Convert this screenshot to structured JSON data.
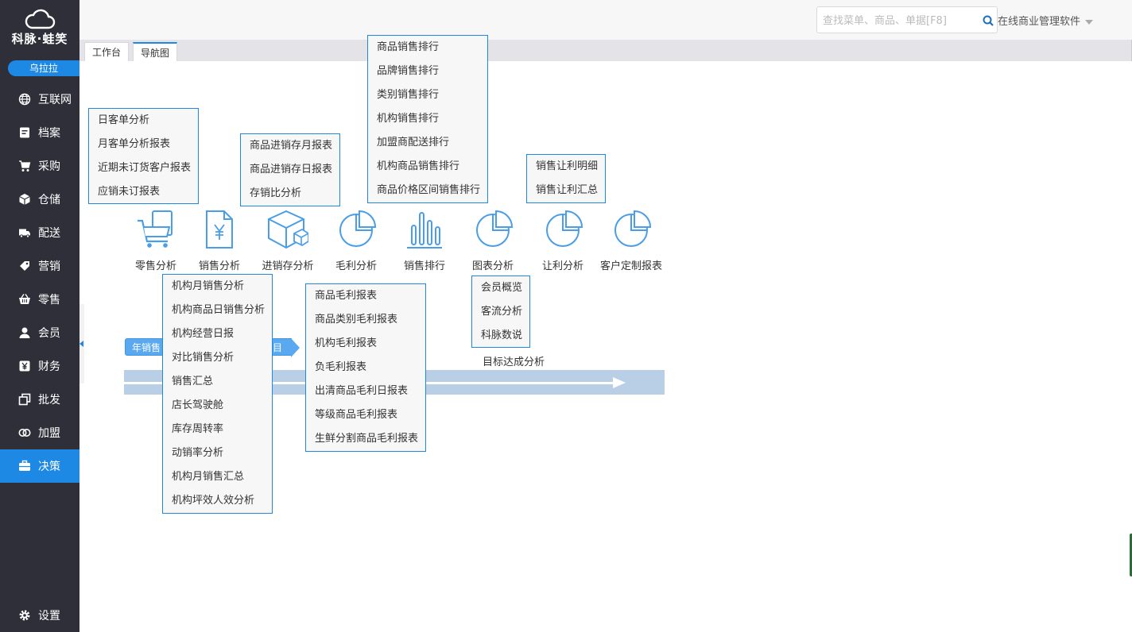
{
  "brand": {
    "name": "科脉·蛙笑",
    "user": "乌拉拉"
  },
  "sidebar": {
    "items": [
      {
        "label": "互联网",
        "icon": "globe-icon"
      },
      {
        "label": "档案",
        "icon": "file-icon"
      },
      {
        "label": "采购",
        "icon": "cart-icon"
      },
      {
        "label": "仓储",
        "icon": "box-icon"
      },
      {
        "label": "配送",
        "icon": "truck-icon"
      },
      {
        "label": "营销",
        "icon": "tag-icon"
      },
      {
        "label": "零售",
        "icon": "basket-icon"
      },
      {
        "label": "会员",
        "icon": "user-icon"
      },
      {
        "label": "财务",
        "icon": "yen-icon"
      },
      {
        "label": "批发",
        "icon": "copy-icon"
      },
      {
        "label": "加盟",
        "icon": "rings-icon"
      },
      {
        "label": "决策",
        "icon": "briefcase-icon",
        "active": true
      }
    ],
    "settings": "设置"
  },
  "topbar": {
    "search_placeholder": "查找菜单、商品、单据[F8]",
    "app_title": "在线商业管理软件"
  },
  "tabs": [
    {
      "label": "工作台"
    },
    {
      "label": "导航图",
      "active": true
    }
  ],
  "modules": [
    {
      "label": "零售分析",
      "icon": "cart-icon"
    },
    {
      "label": "销售分析",
      "icon": "yen-doc-icon"
    },
    {
      "label": "进销存分析",
      "icon": "cube-icon"
    },
    {
      "label": "毛利分析",
      "icon": "pie-chart-icon"
    },
    {
      "label": "销售排行",
      "icon": "bar-chart-icon"
    },
    {
      "label": "图表分析",
      "icon": "pie-chart-icon"
    },
    {
      "label": "让利分析",
      "icon": "pie-chart-icon"
    },
    {
      "label": "客户定制报表",
      "icon": "pie-chart-icon"
    }
  ],
  "menus": {
    "retail": [
      "日客单分析",
      "月客单分析报表",
      "近期未订货客户报表",
      "应销未订报表"
    ],
    "inventory": [
      "商品进销存月报表",
      "商品进销存日报表",
      "存销比分析"
    ],
    "ranking": [
      "商品销售排行",
      "品牌销售排行",
      "类别销售排行",
      "机构销售排行",
      "加盟商配送排行",
      "机构商品销售排行",
      "商品价格区间销售排行"
    ],
    "discount": [
      "销售让利明细",
      "销售让利汇总"
    ],
    "sales": [
      "机构月销售分析",
      "机构商品日销售分析",
      "机构经营日报",
      "对比销售分析",
      "销售汇总",
      "店长驾驶舱",
      "库存周转率",
      "动销率分析",
      "机构月销售汇总",
      "机构坪效人效分析"
    ],
    "margin": [
      "商品毛利报表",
      "商品类别毛利报表",
      "机构毛利报表",
      "负毛利报表",
      "出清商品毛利日报表",
      "等级商品毛利报表",
      "生鲜分割商品毛利报表"
    ],
    "charts": [
      "会员概览",
      "客流分析",
      "科脉数说"
    ]
  },
  "flow": {
    "tag1": "年销售",
    "tag2": "目标",
    "goal": "目标达成分析"
  },
  "colors": {
    "sidebar": "#2f2f3a",
    "accent": "#1e88e5",
    "icon_blue": "#4a9ee8"
  }
}
